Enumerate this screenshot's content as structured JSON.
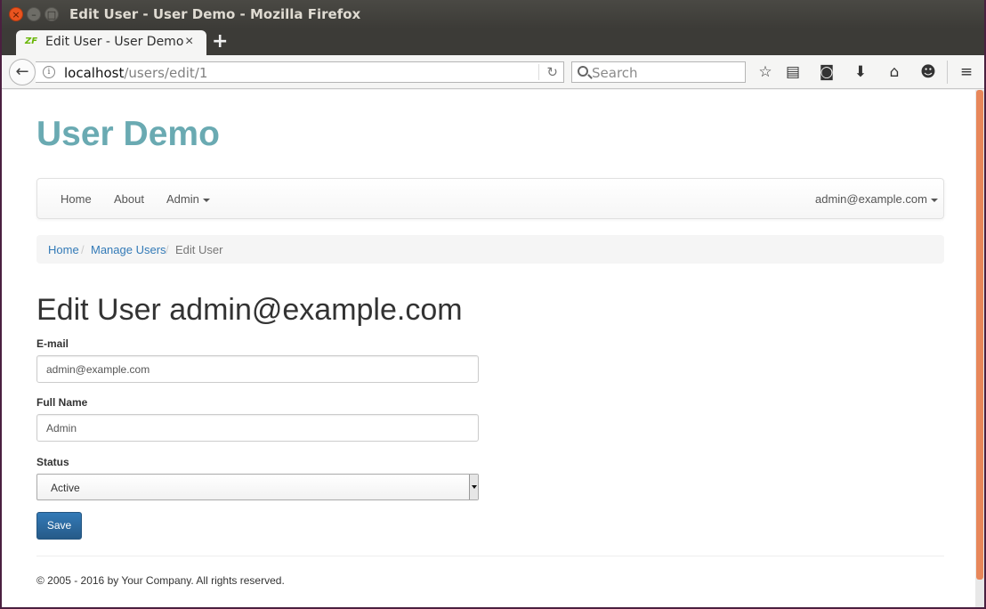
{
  "window": {
    "title": "Edit User - User Demo - Mozilla Firefox"
  },
  "tab": {
    "favicon": "ZF",
    "label": "Edit User - User Demo",
    "close": "×",
    "new_tab": "+"
  },
  "browser": {
    "back": "←",
    "url_host": "localhost",
    "url_path": "/users/edit/1",
    "reload": "↻",
    "search_placeholder": "Search",
    "icons": [
      "star-icon",
      "reading-list-icon",
      "pocket-icon",
      "download-icon",
      "home-icon",
      "hello-icon",
      "menu-icon"
    ]
  },
  "app": {
    "brand": "User Demo",
    "nav": {
      "home": "Home",
      "about": "About",
      "admin": "Admin",
      "user": "admin@example.com"
    },
    "breadcrumb": {
      "home": "Home",
      "manage": "Manage Users",
      "current": "Edit User",
      "separator": "/"
    },
    "page_title": "Edit User admin@example.com",
    "form": {
      "email_label": "E-mail",
      "email_value": "admin@example.com",
      "fullname_label": "Full Name",
      "fullname_value": "Admin",
      "status_label": "Status",
      "status_value": "Active",
      "save_label": "Save"
    },
    "footer": "© 2005 - 2016 by Your Company. All rights reserved."
  },
  "colors": {
    "brand": "#6aaab2",
    "link": "#337ab7",
    "primary_button": "#337ab7",
    "scroll_accent": "#e8875a"
  }
}
